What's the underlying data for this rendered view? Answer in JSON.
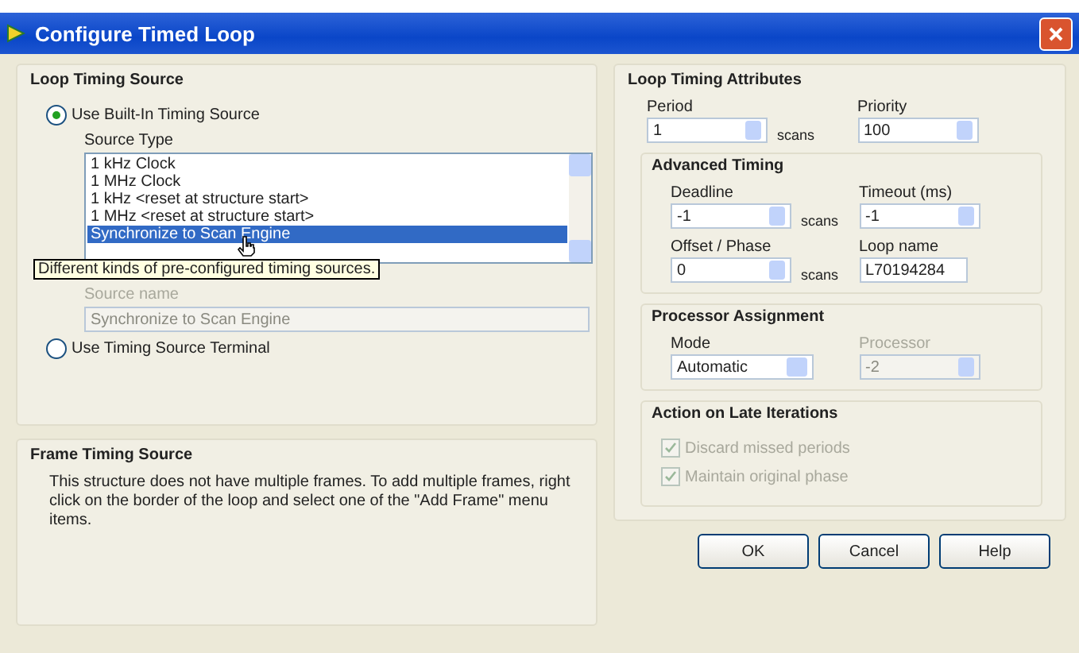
{
  "window": {
    "title": "Configure Timed Loop"
  },
  "loop_timing_source": {
    "title": "Loop Timing Source",
    "options": [
      {
        "label": "Use Built-In Timing Source",
        "selected": true
      },
      {
        "label": "Use Timing Source Terminal",
        "selected": false
      }
    ],
    "source_type": {
      "label": "Source Type",
      "items": [
        {
          "label": "1 kHz Clock",
          "selected": false
        },
        {
          "label": "1 MHz Clock",
          "selected": false
        },
        {
          "label": "1 kHz <reset at structure start>",
          "selected": false
        },
        {
          "label": "1 MHz <reset at structure start>",
          "selected": false
        },
        {
          "label": "Synchronize to Scan Engine",
          "selected": true
        }
      ]
    },
    "tooltip": "Different kinds of pre-configured timing sources.",
    "source_name": {
      "label": "Source name",
      "value": "Synchronize to Scan Engine",
      "disabled": true
    }
  },
  "frame_timing_source": {
    "title": "Frame Timing Source",
    "text": "This structure does not have multiple frames. To add multiple frames, right click on the border of the loop and select one of the \"Add Frame\" menu items."
  },
  "loop_timing_attributes": {
    "title": "Loop Timing Attributes",
    "fields": [
      {
        "label": "Period",
        "value": "1",
        "unit": "scans",
        "kind": "spin"
      },
      {
        "label": "Priority",
        "value": "100",
        "kind": "spin"
      }
    ],
    "advanced_timing": {
      "title": "Advanced Timing",
      "fields": [
        {
          "label": "Deadline",
          "value": "-1",
          "unit": "scans",
          "kind": "spin"
        },
        {
          "label": "Timeout (ms)",
          "value": "-1",
          "kind": "spin"
        },
        {
          "label": "Offset / Phase",
          "value": "0",
          "unit": "scans",
          "kind": "spin"
        },
        {
          "label": "Loop name",
          "value": "L70194284",
          "kind": "text"
        }
      ]
    }
  },
  "processor_assignment": {
    "title": "Processor Assignment",
    "fields": [
      {
        "label": "Mode",
        "value": "Automatic",
        "kind": "dropdown",
        "disabled": false
      },
      {
        "label": "Processor",
        "value": "-2",
        "kind": "spin",
        "disabled": true
      }
    ]
  },
  "action_on_late_iterations": {
    "title": "Action on Late Iterations",
    "options": [
      {
        "label": "Discard missed periods",
        "checked": true,
        "disabled": true
      },
      {
        "label": "Maintain original phase",
        "checked": true,
        "disabled": true
      }
    ]
  },
  "buttons": [
    "OK",
    "Cancel",
    "Help"
  ]
}
